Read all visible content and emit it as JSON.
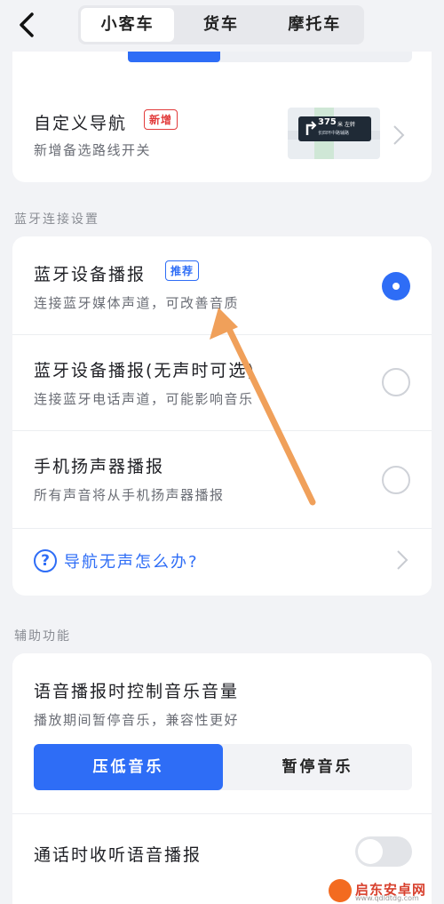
{
  "header": {
    "tabs": [
      {
        "label": "小客车",
        "active": true
      },
      {
        "label": "货车",
        "active": false
      },
      {
        "label": "摩托车",
        "active": false
      }
    ]
  },
  "nav_card": {
    "title": "自定义导航",
    "badge": "新增",
    "subtitle": "新增备选路线开关",
    "thumb": {
      "distance": "375",
      "unit": "米",
      "action": "左转",
      "road": "长四环中路辅路"
    }
  },
  "bluetooth_section": {
    "title": "蓝牙连接设置",
    "options": [
      {
        "title": "蓝牙设备播报",
        "badge": "推荐",
        "subtitle": "连接蓝牙媒体声道，可改善音质",
        "selected": true
      },
      {
        "title": "蓝牙设备播报(无声时可选)",
        "subtitle": "连接蓝牙电话声道，可能影响音乐",
        "selected": false
      },
      {
        "title": "手机扬声器播报",
        "subtitle": "所有声音将从手机扬声器播报",
        "selected": false
      }
    ],
    "help_text": "导航无声怎么办?"
  },
  "assist_section": {
    "title": "辅助功能",
    "music_control": {
      "title": "语音播报时控制音乐音量",
      "subtitle": "播放期间暂停音乐，兼容性更好",
      "options": [
        "压低音乐",
        "暂停音乐"
      ],
      "selected": "压低音乐"
    },
    "call_broadcast": {
      "title": "通话时收听语音播报",
      "enabled": false
    }
  },
  "watermark": {
    "text": "启东安卓网",
    "url": "www.qdldtdg.com"
  },
  "colors": {
    "accent": "#2e6df6",
    "badge_red": "#e23b3b",
    "annotation_arrow": "#f0a05a"
  }
}
